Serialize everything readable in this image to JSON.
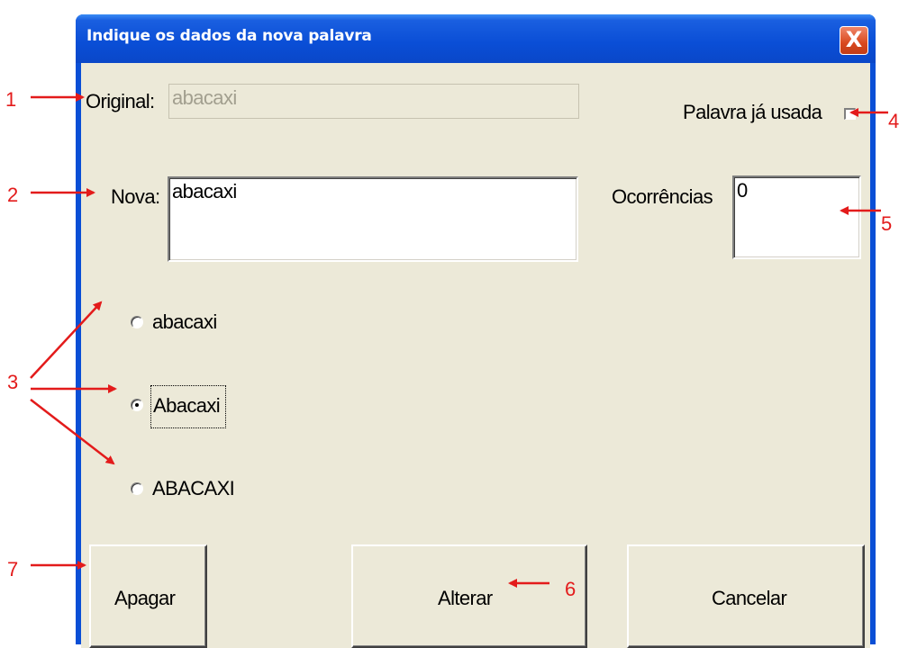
{
  "window": {
    "title": "Indique os dados da nova palavra",
    "close_glyph": "X"
  },
  "form": {
    "original_label": "Original:",
    "original_value": "abacaxi",
    "palavra_usada_label": "Palavra já usada",
    "palavra_usada_checked": false,
    "nova_label": "Nova:",
    "nova_value": "abacaxi",
    "ocorrencias_label": "Ocorrências",
    "ocorrencias_value": "0",
    "case_options": [
      {
        "label": "abacaxi",
        "selected": false
      },
      {
        "label": "Abacaxi",
        "selected": true
      },
      {
        "label": "ABACAXI",
        "selected": false
      }
    ]
  },
  "buttons": {
    "apagar": "Apagar",
    "alterar": "Alterar",
    "cancelar": "Cancelar"
  },
  "annotations": {
    "n1": "1",
    "n2": "2",
    "n3": "3",
    "n4": "4",
    "n5": "5",
    "n6": "6",
    "n7": "7",
    "color": "#e31b1b"
  },
  "colors": {
    "titlebar": "#0a4ed6",
    "dialog_face": "#ece9d8",
    "close_button": "#d9491e"
  }
}
